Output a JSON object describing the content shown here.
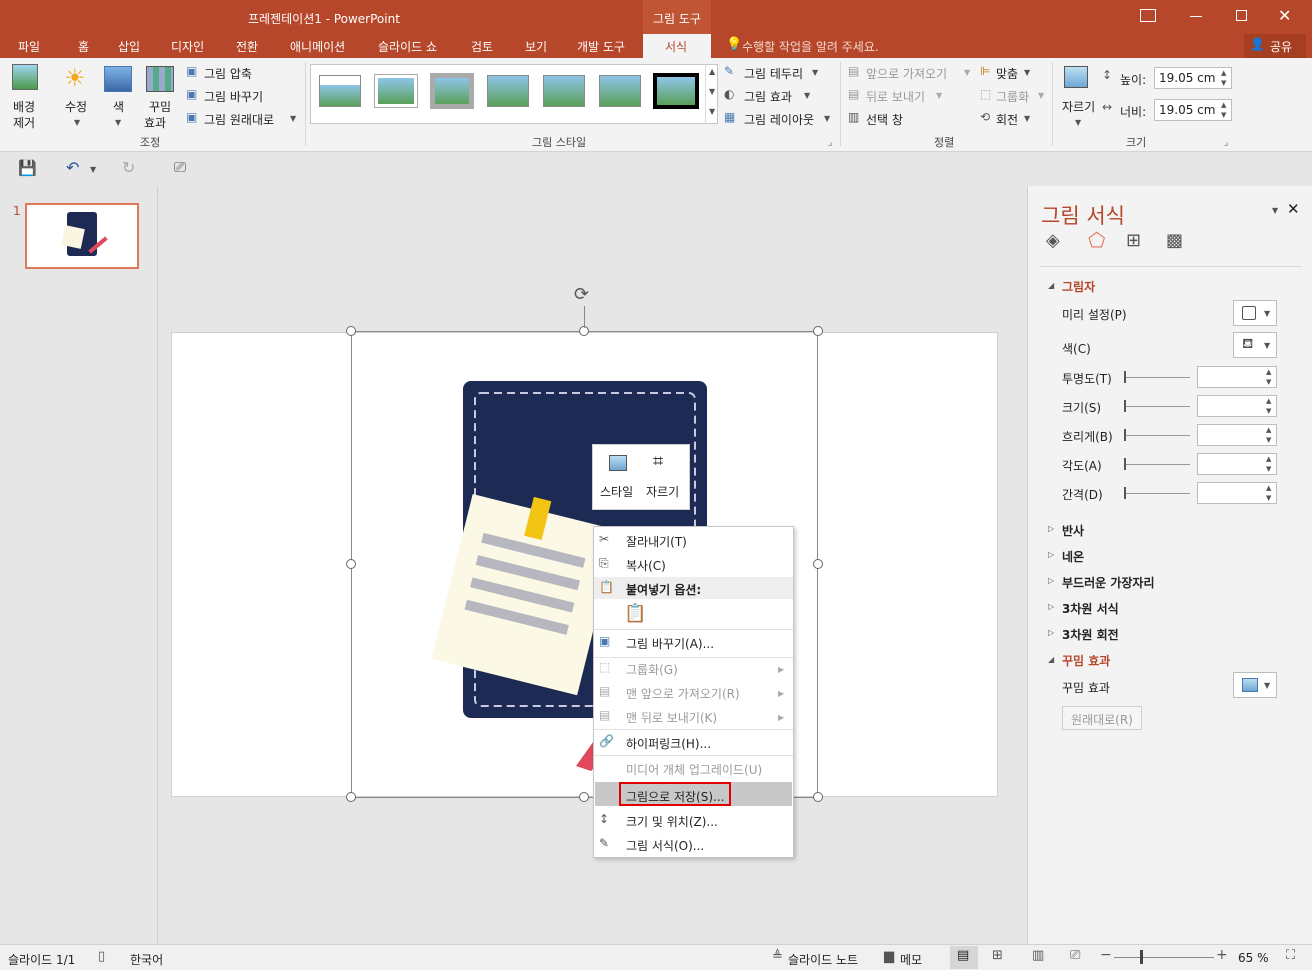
{
  "title": {
    "doc": "프레젠테이션1 - PowerPoint",
    "tool_context": "그림 도구"
  },
  "tabs": {
    "file": "파일",
    "home": "홈",
    "insert": "삽입",
    "design": "디자인",
    "transitions": "전환",
    "animations": "애니메이션",
    "slideshow": "슬라이드 쇼",
    "review": "검토",
    "view": "보기",
    "developer": "개발 도구",
    "format": "서식",
    "tellme": "수행할 작업을 알려 주세요.",
    "share": "공유"
  },
  "ribbon": {
    "remove_bg_1": "배경",
    "remove_bg_2": "제거",
    "corrections": "수정",
    "color": "색",
    "artistic_1": "꾸밈",
    "artistic_2": "효과",
    "compress": "그림 압축",
    "change": "그림 바꾸기",
    "reset": "그림 원래대로",
    "group_adjust": "조정",
    "border": "그림 테두리",
    "effects": "그림 효과",
    "layout": "그림 레이아웃",
    "group_styles": "그림 스타일",
    "bring_forward": "앞으로 가져오기",
    "send_backward": "뒤로 보내기",
    "selection_pane": "선택 창",
    "align": "맞춤",
    "group": "그룹화",
    "rotate": "회전",
    "group_arrange": "정렬",
    "crop": "자르기",
    "height_label": "높이:",
    "height": "19.05 cm",
    "width_label": "너비:",
    "width": "19.05 cm",
    "group_size": "크기"
  },
  "thumb_number": "1",
  "minitoolbar": {
    "style": "스타일",
    "crop": "자르기"
  },
  "context_menu": {
    "cut": "잘라내기(T)",
    "copy": "복사(C)",
    "paste_options": "붙여넣기 옵션:",
    "change_picture": "그림 바꾸기(A)...",
    "group": "그룹화(G)",
    "bring_front": "맨 앞으로 가져오기(R)",
    "send_back": "맨 뒤로 보내기(K)",
    "hyperlink": "하이퍼링크(H)...",
    "media_upgrade": "미디어 개체 업그레이드(U)",
    "save_as_picture": "그림으로 저장(S)...",
    "size_position": "크기 및 위치(Z)...",
    "format_picture": "그림 서식(O)..."
  },
  "format_pane": {
    "title": "그림 서식",
    "shadow": "그림자",
    "presets": "미리 설정(P)",
    "color": "색(C)",
    "transparency": "투명도(T)",
    "size": "크기(S)",
    "blur": "흐리게(B)",
    "angle": "각도(A)",
    "distance": "간격(D)",
    "reflection": "반사",
    "glow": "네온",
    "soft_edges": "부드러운 가장자리",
    "format3d": "3차원 서식",
    "rotation3d": "3차원 회전",
    "artistic": "꾸밈 효과",
    "artistic_label": "꾸밈 효과",
    "reset": "원래대로(R)"
  },
  "status": {
    "slide": "슬라이드 1/1",
    "language": "한국어",
    "notes": "슬라이드 노트",
    "comments": "메모",
    "zoom": "65 %"
  },
  "colors": {
    "accent": "#b7472a",
    "navy": "#1c2a54"
  }
}
